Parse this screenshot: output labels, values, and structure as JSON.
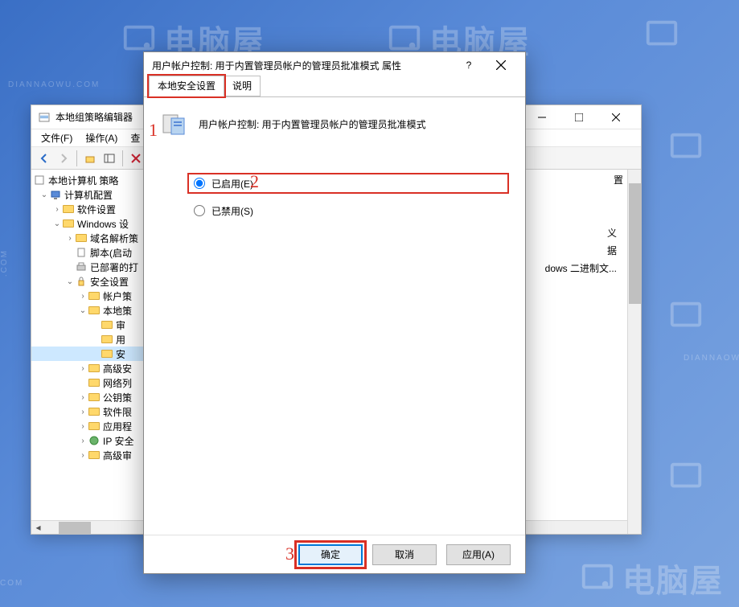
{
  "watermark": {
    "brand": "电脑屋",
    "url": "DIANNAOWU.COM"
  },
  "gpedit": {
    "title": "本地组策略编辑器",
    "menus": [
      "文件(F)",
      "操作(A)",
      "查"
    ],
    "tree": {
      "root": "本地计算机 策略",
      "computer_config": "计算机配置",
      "software_settings": "软件设置",
      "windows_settings": "Windows 设",
      "dns_policy": "域名解析策",
      "scripts": "脚本(启动",
      "deployed": "已部署的打",
      "security_settings": "安全设置",
      "account_policies": "帐户策",
      "local_policies": "本地策",
      "audit": "审",
      "user_rights": "用",
      "security_options": "安",
      "advanced_security": "高级安",
      "network_list": "网络列",
      "public_key": "公钥策",
      "software_restriction": "软件限",
      "app_control": "应用程",
      "ip_security": "IP 安全",
      "advanced_audit": "高级审"
    },
    "right_panel": {
      "col_header": "置",
      "item1": "义",
      "item2": "据",
      "item3": "dows 二进制文..."
    }
  },
  "dialog": {
    "title": "用户帐户控制: 用于内置管理员帐户的管理员批准模式 属性",
    "tabs": {
      "settings": "本地安全设置",
      "explain": "说明"
    },
    "policy_name": "用户帐户控制: 用于内置管理员帐户的管理员批准模式",
    "radio_enabled": "已启用(E)",
    "radio_disabled": "已禁用(S)",
    "buttons": {
      "ok": "确定",
      "cancel": "取消",
      "apply": "应用(A)"
    },
    "annotations": {
      "a1": "1",
      "a2": "2",
      "a3": "3"
    }
  }
}
